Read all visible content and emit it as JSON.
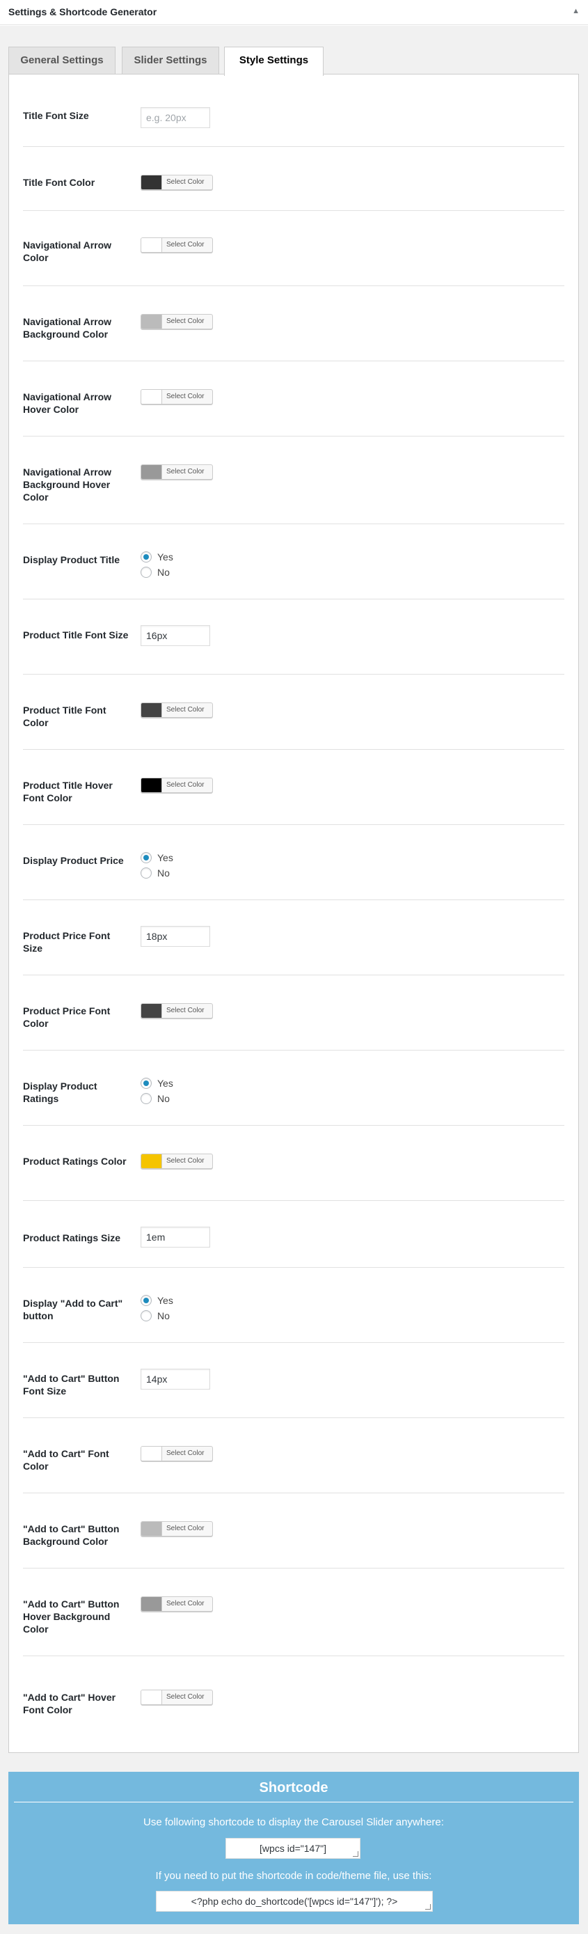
{
  "header": {
    "title": "Settings & Shortcode Generator",
    "toggle": "▲"
  },
  "tabs": [
    {
      "label": "General Settings",
      "active": false
    },
    {
      "label": "Slider Settings",
      "active": false
    },
    {
      "label": "Style Settings",
      "active": true
    }
  ],
  "rows": [
    {
      "label": "Title Font Size",
      "type": "text",
      "value": "",
      "placeholder": "e.g. 20px"
    },
    {
      "label": "Title Font Color",
      "type": "color",
      "color": "#333333",
      "button_label": "Select Color"
    },
    {
      "label": "Navigational Arrow Color",
      "type": "color",
      "color": "#ffffff",
      "button_label": "Select Color"
    },
    {
      "label": "Navigational Arrow Background Color",
      "type": "color",
      "color": "#bbbbbb",
      "button_label": "Select Color"
    },
    {
      "label": "Navigational Arrow Hover Color",
      "type": "color",
      "color": "#ffffff",
      "button_label": "Select Color"
    },
    {
      "label": "Navigational Arrow Background Hover Color",
      "type": "color",
      "color": "#999999",
      "button_label": "Select Color"
    },
    {
      "label": "Display Product Title",
      "type": "radio",
      "options": [
        "Yes",
        "No"
      ],
      "selected": 0
    },
    {
      "label": "Product Title Font Size",
      "type": "text",
      "value": "16px",
      "placeholder": ""
    },
    {
      "label": "Product Title Font Color",
      "type": "color",
      "color": "#444444",
      "button_label": "Select Color"
    },
    {
      "label": "Product Title Hover Font Color",
      "type": "color",
      "color": "#000000",
      "button_label": "Select Color"
    },
    {
      "label": "Display Product Price",
      "type": "radio",
      "options": [
        "Yes",
        "No"
      ],
      "selected": 0
    },
    {
      "label": "Product Price Font Size",
      "type": "text",
      "value": "18px",
      "placeholder": ""
    },
    {
      "label": "Product Price Font Color",
      "type": "color",
      "color": "#444444",
      "button_label": "Select Color"
    },
    {
      "label": "Display Product Ratings",
      "type": "radio",
      "options": [
        "Yes",
        "No"
      ],
      "selected": 0
    },
    {
      "label": "Product Ratings Color",
      "type": "color",
      "color": "#f5c400",
      "button_label": "Select Color"
    },
    {
      "label": "Product Ratings Size",
      "type": "text",
      "value": "1em",
      "placeholder": ""
    },
    {
      "label": "Display \"Add to Cart\" button",
      "type": "radio",
      "options": [
        "Yes",
        "No"
      ],
      "selected": 0
    },
    {
      "label": "\"Add to Cart\" Button Font Size",
      "type": "text",
      "value": "14px",
      "placeholder": ""
    },
    {
      "label": "\"Add to Cart\" Font Color",
      "type": "color",
      "color": "#ffffff",
      "button_label": "Select Color"
    },
    {
      "label": "\"Add to Cart\" Button Background Color",
      "type": "color",
      "color": "#bbbbbb",
      "button_label": "Select Color"
    },
    {
      "label": "\"Add to Cart\" Button Hover Background Color",
      "type": "color",
      "color": "#999999",
      "button_label": "Select Color"
    },
    {
      "label": "\"Add to Cart\" Hover Font Color",
      "type": "color",
      "color": "#ffffff",
      "button_label": "Select Color"
    }
  ],
  "shortcode": {
    "title": "Shortcode",
    "desc1": "Use following shortcode to display the Carousel Slider anywhere:",
    "code1": "[wpcs id=\"147\"]",
    "desc2": "If you need to put the shortcode in code/theme file, use this:",
    "code2": "<?php echo do_shortcode('[wpcs id=\"147\"]'); ?>",
    "background": "#74b9de"
  }
}
